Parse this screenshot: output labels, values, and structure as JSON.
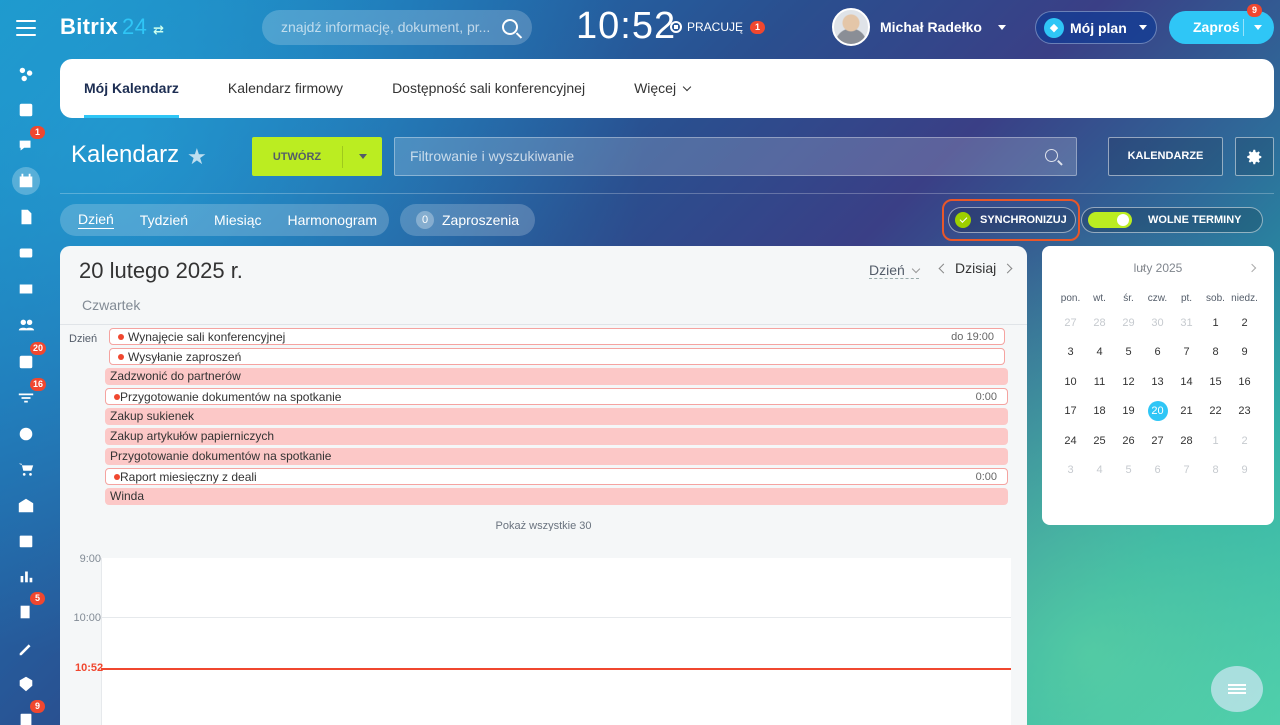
{
  "app": {
    "brand": "Bitrix",
    "brand_num": "24",
    "clock": "10:52",
    "work_status": "PRACUJĘ",
    "work_badge": "1"
  },
  "search": {
    "placeholder": "znajdź informację, dokument, pr..."
  },
  "user": {
    "name": "Michał Radełko"
  },
  "plan": {
    "label": "Mój plan"
  },
  "invite": {
    "label": "Zaproś",
    "badge": "9"
  },
  "rail": {
    "badges": {
      "chat": "1",
      "tasks": "20",
      "crm": "16",
      "forms": "5",
      "contacts": "9"
    }
  },
  "tabs": [
    {
      "label": "Mój Kalendarz"
    },
    {
      "label": "Kalendarz firmowy"
    },
    {
      "label": "Dostępność sali konferencyjnej"
    },
    {
      "label": "Więcej"
    }
  ],
  "toolbar": {
    "title": "Kalendarz",
    "create": "UTWÓRZ",
    "filter_placeholder": "Filtrowanie i wyszukiwanie",
    "calendars": "KALENDARZE"
  },
  "views": {
    "day": "Dzień",
    "week": "Tydzień",
    "month": "Miesiąc",
    "schedule": "Harmonogram",
    "invites_count": "0",
    "invites": "Zaproszenia"
  },
  "sync": {
    "label": "SYNCHRONIZUJ"
  },
  "free": {
    "label": "WOLNE TERMINY",
    "enabled": true
  },
  "day": {
    "date": "20 lutego 2025 r.",
    "weekday": "Czwartek",
    "mode": "Dzień",
    "today": "Dzisiaj",
    "allday_label": "Dzień"
  },
  "events": [
    {
      "title": "Wynajęcie sali konferencyjnej",
      "time": "do 19:00",
      "style": "outline"
    },
    {
      "title": "Wysyłanie zaproszeń",
      "time": "",
      "style": "outline"
    },
    {
      "title": "Zadzwonić do partnerów",
      "time": "",
      "style": "fill"
    },
    {
      "title": "Przygotowanie dokumentów na spotkanie",
      "time": "0:00",
      "style": "outline"
    },
    {
      "title": "Zakup sukienek",
      "time": "",
      "style": "fill"
    },
    {
      "title": "Zakup artykułów papierniczych",
      "time": "",
      "style": "fill"
    },
    {
      "title": "Przygotowanie dokumentów na spotkanie",
      "time": "",
      "style": "fill"
    },
    {
      "title": "Raport miesięczny z deali",
      "time": "0:00",
      "style": "outline"
    },
    {
      "title": "Winda",
      "time": "",
      "style": "fill"
    }
  ],
  "show_all": "Pokaż wszystkie 30",
  "hours": [
    "9:00",
    "10:00"
  ],
  "now_label": "10:52",
  "mini": {
    "month": "luty 2025",
    "weekdays": [
      "pon.",
      "wt.",
      "śr.",
      "czw.",
      "pt.",
      "sob.",
      "niedz."
    ],
    "weeks": [
      [
        {
          "d": "27",
          "o": true
        },
        {
          "d": "28",
          "o": true
        },
        {
          "d": "29",
          "o": true
        },
        {
          "d": "30",
          "o": true
        },
        {
          "d": "31",
          "o": true
        },
        {
          "d": "1"
        },
        {
          "d": "2"
        }
      ],
      [
        {
          "d": "3"
        },
        {
          "d": "4"
        },
        {
          "d": "5"
        },
        {
          "d": "6"
        },
        {
          "d": "7"
        },
        {
          "d": "8"
        },
        {
          "d": "9"
        }
      ],
      [
        {
          "d": "10"
        },
        {
          "d": "11"
        },
        {
          "d": "12"
        },
        {
          "d": "13"
        },
        {
          "d": "14"
        },
        {
          "d": "15"
        },
        {
          "d": "16"
        }
      ],
      [
        {
          "d": "17"
        },
        {
          "d": "18"
        },
        {
          "d": "19"
        },
        {
          "d": "20",
          "t": true
        },
        {
          "d": "21"
        },
        {
          "d": "22"
        },
        {
          "d": "23"
        }
      ],
      [
        {
          "d": "24"
        },
        {
          "d": "25"
        },
        {
          "d": "26"
        },
        {
          "d": "27"
        },
        {
          "d": "28"
        },
        {
          "d": "1",
          "o": true
        },
        {
          "d": "2",
          "o": true
        }
      ],
      [
        {
          "d": "3",
          "o": true
        },
        {
          "d": "4",
          "o": true
        },
        {
          "d": "5",
          "o": true
        },
        {
          "d": "6",
          "o": true
        },
        {
          "d": "7",
          "o": true
        },
        {
          "d": "8",
          "o": true
        },
        {
          "d": "9",
          "o": true
        }
      ]
    ]
  }
}
